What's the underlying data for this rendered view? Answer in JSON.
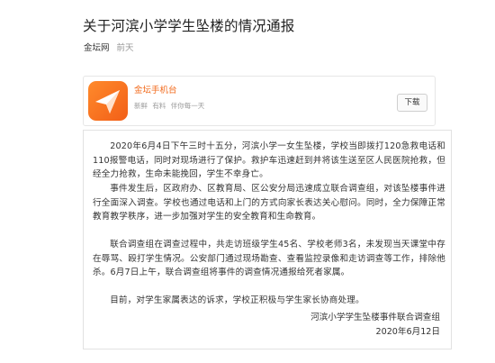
{
  "article": {
    "title": "关于河滨小学学生坠楼的情况通报",
    "source": "金坛网",
    "time": "前天"
  },
  "app_banner": {
    "logo_icon": "paper-plane-icon",
    "name": "金坛手机台",
    "tags": [
      "新鲜",
      "有料",
      "伴你每一天"
    ],
    "download_label": "下载",
    "brand_color": "#f26a1b"
  },
  "notice": {
    "paragraphs": [
      "2020年6月4日下午三时十五分，河滨小学一女生坠楼，学校当即拨打120急救电话和110报警电话，同时对现场进行了保护。救护车迅速赶到并将该生送至区人民医院抢救，但经全力抢救，生命未能挽回，学生不幸身亡。",
      "事件发生后，区政府办、区教育局、区公安分局迅速成立联合调查组，对该坠楼事件进行全面深入调查。学校也通过电话和上门的方式向家长表达关心慰问。同时，全力保障正常教育教学秩序，进一步加强对学生的安全教育和生命教育。",
      "联合调查组在调查过程中，共走访班级学生45名、学校老师3名，未发现当天课堂中存在辱骂、殴打学生情况。公安部门通过现场勘查、查看监控录像和走访调查等工作，排除他杀。6月7日上午，联合调查组将事件的调查情况通报给死者家属。",
      "目前，对学生家属表达的诉求，学校正积极与学生家长协商处理。"
    ],
    "signature": "河滨小学学生坠楼事件联合调查组",
    "date": "2020年6月12日"
  }
}
